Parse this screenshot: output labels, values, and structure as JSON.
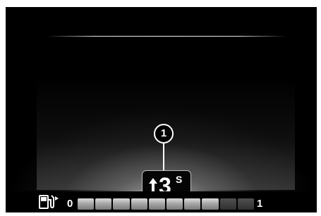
{
  "callout": {
    "label": "1"
  },
  "gear": {
    "arrow_icon": "upshift-arrow-icon",
    "number": "3",
    "mode": "S"
  },
  "fuel_economy": {
    "icon": "fuel-pump-icon",
    "min_label": "0",
    "max_label": "1",
    "segments_total": 10,
    "segments_lit": 8
  }
}
